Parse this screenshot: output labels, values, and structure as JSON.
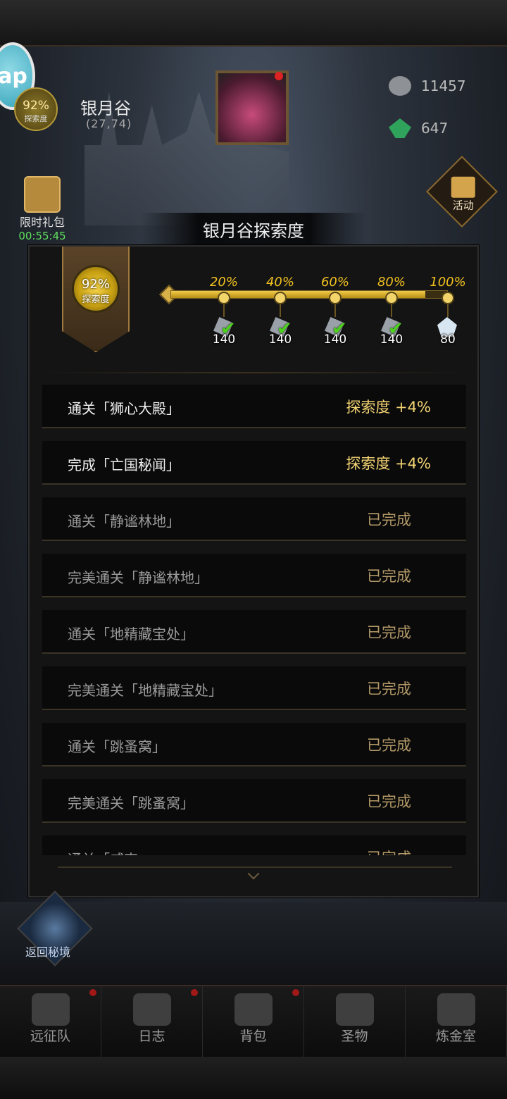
{
  "hud": {
    "ap_label": "ap",
    "explore_percent": "92%",
    "explore_label": "探索度",
    "region_name": "银月谷",
    "region_coord": "(27,74)",
    "resources": [
      {
        "icon": "stone-icon",
        "value": "11457"
      },
      {
        "icon": "gem-icon",
        "value": "647"
      }
    ],
    "gift": {
      "label": "限时礼包",
      "timer": "00:55:45"
    },
    "activity_label": "活动"
  },
  "popup": {
    "title": "银月谷探索度",
    "badge_percent": "92%",
    "badge_label": "探索度",
    "progress": 0.92,
    "milestones": [
      {
        "label": "20%",
        "reward": "140",
        "claimed": true,
        "item": "arrow-token-icon"
      },
      {
        "label": "40%",
        "reward": "140",
        "claimed": true,
        "item": "arrow-token-icon"
      },
      {
        "label": "60%",
        "reward": "140",
        "claimed": true,
        "item": "arrow-token-icon"
      },
      {
        "label": "80%",
        "reward": "140",
        "claimed": true,
        "item": "arrow-token-icon"
      },
      {
        "label": "100%",
        "reward": "80",
        "claimed": false,
        "item": "crystal-icon"
      }
    ],
    "tasks": [
      {
        "name": "通关「狮心大殿」",
        "status": "探索度 +4%",
        "done": false
      },
      {
        "name": "完成「亡国秘闻」",
        "status": "探索度 +4%",
        "done": false
      },
      {
        "name": "通关「静谧林地」",
        "status": "已完成",
        "done": true
      },
      {
        "name": "完美通关「静谧林地」",
        "status": "已完成",
        "done": true
      },
      {
        "name": "通关「地精藏宝处」",
        "status": "已完成",
        "done": true
      },
      {
        "name": "完美通关「地精藏宝处」",
        "status": "已完成",
        "done": true
      },
      {
        "name": "通关「跳蚤窝」",
        "status": "已完成",
        "done": true
      },
      {
        "name": "完美通关「跳蚤窝」",
        "status": "已完成",
        "done": true
      },
      {
        "name": "通关「威克",
        "status": "已完成",
        "done": true
      }
    ]
  },
  "portal_label": "返回秘境",
  "nav": [
    {
      "label": "远征队",
      "icon": "helmet-icon",
      "dot": true
    },
    {
      "label": "日志",
      "icon": "scroll-icon",
      "dot": true
    },
    {
      "label": "背包",
      "icon": "backpack-icon",
      "dot": true
    },
    {
      "label": "圣物",
      "icon": "torch-icon",
      "dot": false
    },
    {
      "label": "炼金室",
      "icon": "alchemy-icon",
      "dot": false
    }
  ],
  "colors": {
    "gold": "#f0c020",
    "pending_status": "#f4d474",
    "done_status": "#b49a68",
    "check": "#4ed01e"
  }
}
